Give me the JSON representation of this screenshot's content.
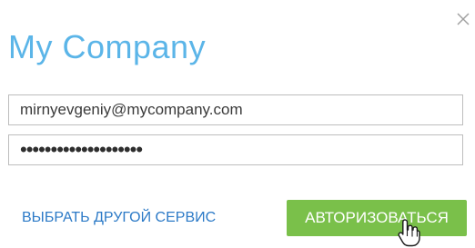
{
  "dialog": {
    "title": "My Company",
    "close_icon": "close-icon"
  },
  "login": {
    "email_value": "mirnyevgeniy@mycompany.com",
    "password_value": "••••••••••••••••••••"
  },
  "actions": {
    "other_service_label": "ВЫБРАТЬ ДРУГОЙ СЕРВИС",
    "authorize_label": "АВТОРИЗОВАТЬСЯ"
  },
  "colors": {
    "title": "#5bb5e8",
    "link": "#2c7ac7",
    "primary_button": "#7ac04a"
  },
  "cursor_icon": "hand-pointer-icon"
}
